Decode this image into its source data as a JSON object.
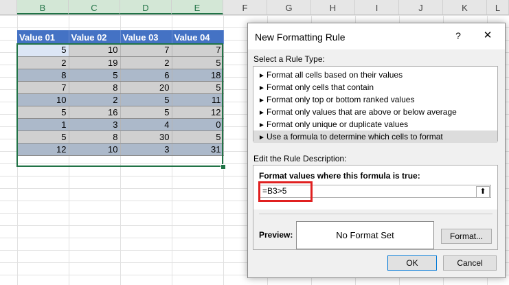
{
  "columns": [
    "B",
    "C",
    "D",
    "E",
    "F",
    "G",
    "H",
    "I",
    "J",
    "K",
    "L"
  ],
  "table": {
    "headers": [
      "Value 01",
      "Value 02",
      "Value 03",
      "Value 04"
    ],
    "rows": [
      [
        "5",
        "10",
        "7",
        "7"
      ],
      [
        "2",
        "19",
        "2",
        "5"
      ],
      [
        "8",
        "5",
        "6",
        "18"
      ],
      [
        "7",
        "8",
        "20",
        "5"
      ],
      [
        "10",
        "2",
        "5",
        "11"
      ],
      [
        "5",
        "16",
        "5",
        "12"
      ],
      [
        "1",
        "3",
        "4",
        "0"
      ],
      [
        "5",
        "8",
        "30",
        "5"
      ],
      [
        "12",
        "10",
        "3",
        "31"
      ]
    ]
  },
  "dialog": {
    "title": "New Formatting Rule",
    "help": "?",
    "close": "✕",
    "select_label": "Select a Rule Type:",
    "rule_types": [
      "Format all cells based on their values",
      "Format only cells that contain",
      "Format only top or bottom ranked values",
      "Format only values that are above or below average",
      "Format only unique or duplicate values",
      "Use a formula to determine which cells to format"
    ],
    "selected_rule_index": 5,
    "edit_label": "Edit the Rule Description:",
    "formula_label": "Format values where this formula is true:",
    "formula_value": "=B3>5",
    "collapse_icon": "⬆",
    "preview_label": "Preview:",
    "preview_text": "No Format Set",
    "format_button": "Format...",
    "ok_button": "OK",
    "cancel_button": "Cancel"
  },
  "colors": {
    "header_blue": "#4472c4",
    "row_band_a": "#acb9ca",
    "row_band_b": "#d0d0d0",
    "selection_green": "#217346",
    "highlight_red": "#e02020"
  }
}
